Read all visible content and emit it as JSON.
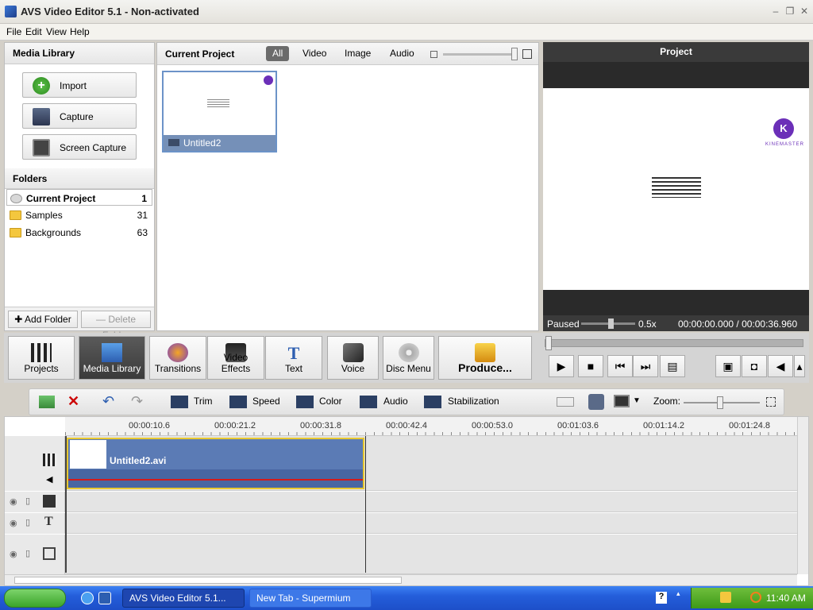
{
  "window": {
    "title": "AVS Video Editor 5.1 - Non-activated"
  },
  "menu": [
    {
      "label": "File"
    },
    {
      "label": "Edit"
    },
    {
      "label": "View"
    },
    {
      "label": "Help"
    }
  ],
  "media_library": {
    "heading": "Media Library",
    "buttons": [
      {
        "label": "Import",
        "icon": "plus-icon"
      },
      {
        "label": "Capture",
        "icon": "camera-icon"
      },
      {
        "label": "Screen Capture",
        "icon": "screen-capture-icon"
      }
    ],
    "folders_heading": "Folders",
    "folders": [
      {
        "name": "Current Project",
        "count": "1"
      },
      {
        "name": "Samples",
        "count": "31"
      },
      {
        "name": "Backgrounds",
        "count": "63"
      }
    ],
    "add_folder": "Add Folder",
    "delete_folder": "Delete Folder"
  },
  "current_project": {
    "heading": "Current Project",
    "filters": [
      "All",
      "Video",
      "Image",
      "Audio"
    ],
    "selected_filter": "All",
    "items": [
      {
        "name": "Untitled2"
      }
    ]
  },
  "preview": {
    "heading": "Project",
    "status": "Paused",
    "speed": "0.5x",
    "time": "00:00:00.000 / 00:00:36.960",
    "brand": "KINEMASTER"
  },
  "toolbar": {
    "buttons": [
      {
        "label": "Projects",
        "icon": "clapper-icon"
      },
      {
        "label": "Media Library",
        "icon": "media-library-icon"
      },
      {
        "label": "Transitions",
        "icon": "transitions-icon"
      },
      {
        "label": "Video Effects",
        "icon": "video-effects-icon"
      },
      {
        "label": "Text",
        "icon": "text-icon"
      },
      {
        "label": "Voice",
        "icon": "microphone-icon"
      },
      {
        "label": "Disc Menu",
        "icon": "disc-menu-icon"
      }
    ],
    "selected": "Media Library",
    "produce": "Produce..."
  },
  "timeline_toolbar": {
    "trim": "Trim",
    "speed": "Speed",
    "color": "Color",
    "audio": "Audio",
    "stabilization": "Stabilization",
    "zoom": "Zoom:"
  },
  "timeline": {
    "ticks": [
      "00:00:10.6",
      "00:00:21.2",
      "00:00:31.8",
      "00:00:42.4",
      "00:00:53.0",
      "00:01:03.6",
      "00:01:14.2",
      "00:01:24.8"
    ],
    "clip": {
      "name": "Untitled2.avi"
    }
  },
  "taskbar": {
    "tasks": [
      {
        "label": "AVS Video Editor 5.1...",
        "active": true
      },
      {
        "label": "New Tab - Supermium",
        "active": false
      }
    ],
    "clock": "11:40 AM"
  },
  "colors": {
    "accent": "#7590b8",
    "taskbar": "#245edb",
    "start": "#3aa52a",
    "clip": "#5b7bb5",
    "selected_tool": "#3a3a3a"
  }
}
